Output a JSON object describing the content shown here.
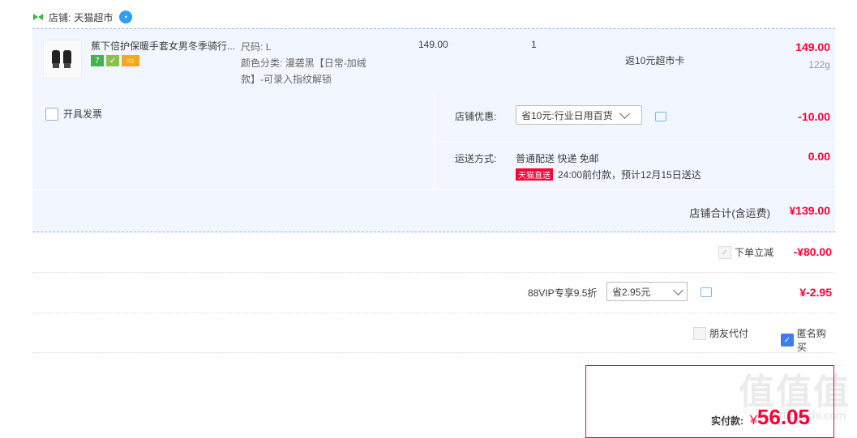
{
  "shop": {
    "label": "店铺:",
    "name": "天猫超市"
  },
  "item": {
    "title": "蕉下倍护保暖手套女男冬季骑行...",
    "size_label": "尺码:",
    "size_value": "L",
    "color_label": "颜色分类:",
    "color_value": "漫砻黑【日常-加绒款】-可录入指纹解锁",
    "unit_price": "149.00",
    "quantity": "1",
    "rebate": "返10元超市卡",
    "total": "149.00",
    "weight": "122g"
  },
  "options": {
    "invoice_label": "开具发票",
    "discount_label": "店铺优惠:",
    "discount_select": "省10元:行业日用百货",
    "discount_amount": "-10.00",
    "shipping_label": "运送方式:",
    "shipping_value": "普通配送 快递 免邮",
    "tmall_badge": "天猫直送",
    "delivery_note": "24:00前付款，预计12月15日送达",
    "shipping_amount": "0.00",
    "shop_total_label": "店铺合计(含运费)",
    "shop_total": "¥139.00"
  },
  "instant_discount": {
    "label": "下单立减",
    "amount": "-¥80.00"
  },
  "vip": {
    "label": "88VIP专享9.5折",
    "select": "省2.95元",
    "amount": "¥-2.95"
  },
  "extras": {
    "friend_pay": "朋友代付",
    "anonymous": "匿名购买"
  },
  "payment": {
    "label": "实付款:",
    "currency": "¥",
    "amount": "56.05"
  },
  "watermark": {
    "text": "值值值",
    "url": "zhizhizhi.com"
  },
  "colors": {
    "accent": "#ff0036",
    "row_bg": "#f2f7ff",
    "check": "#3d7cf0"
  }
}
